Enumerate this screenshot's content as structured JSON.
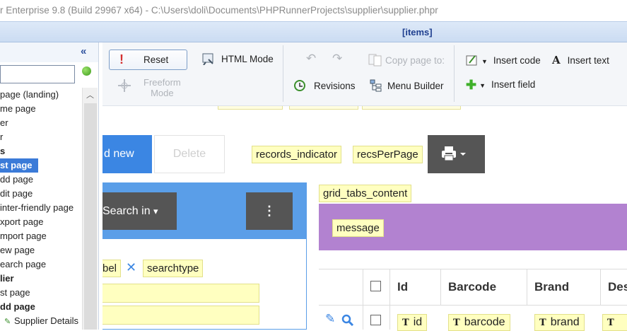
{
  "window": {
    "title": "r Enterprise 9.8 (Build 29967 x64) - C:\\Users\\doli\\Documents\\PHPRunnerProjects\\supplier\\supplier.phpr",
    "doc_title": "[items]"
  },
  "sidebar": {
    "collapse_glyph": "«",
    "search_placeholder": "",
    "items": [
      {
        "label": "page (landing)",
        "style": "normal"
      },
      {
        "label": "me page",
        "style": "normal"
      },
      {
        "label": "er",
        "style": "normal"
      },
      {
        "label": "r",
        "style": "normal"
      },
      {
        "label": "s",
        "style": "bold"
      },
      {
        "label": "st page",
        "style": "selected"
      },
      {
        "label": "dd page",
        "style": "normal"
      },
      {
        "label": "dit page",
        "style": "normal"
      },
      {
        "label": "inter-friendly page",
        "style": "normal"
      },
      {
        "label": "xport page",
        "style": "normal"
      },
      {
        "label": "mport page",
        "style": "normal"
      },
      {
        "label": "ew page",
        "style": "normal"
      },
      {
        "label": "earch page",
        "style": "normal"
      },
      {
        "label": "lier",
        "style": "bold"
      },
      {
        "label": "st page",
        "style": "normal"
      },
      {
        "label": "dd page",
        "style": "bold"
      },
      {
        "label": "Supplier Details",
        "style": "leaf"
      }
    ]
  },
  "toolbar": {
    "reset": "Reset",
    "html_mode": "HTML Mode",
    "freeform_mode_1": "Freeform",
    "freeform_mode_2": "Mode",
    "revisions": "Revisions",
    "copy_page": "Copy page to:",
    "menu_builder": "Menu Builder",
    "insert_code": "Insert code",
    "insert_text": "Insert text",
    "insert_field": "Insert field"
  },
  "page": {
    "add_new": "d new",
    "delete": "Delete",
    "records_indicator": "records_indicator",
    "recs_per_page": "recsPerPage",
    "search_in": "Search in",
    "caret": "▾",
    "kebab": "⋮",
    "grid_tabs_content": "grid_tabs_content",
    "message": "message",
    "label_fragment": "bel",
    "searchtype": "searchtype"
  },
  "grid": {
    "headers": [
      "Id",
      "Barcode",
      "Brand",
      "Des"
    ],
    "fields": [
      "id",
      "barcode",
      "brand",
      ""
    ],
    "field_type_glyph": "T"
  },
  "colors": {
    "accent_blue": "#3b86e3",
    "message_purple": "#b282d0",
    "tag_yellow": "#ffffc0",
    "dark_button": "#555555"
  }
}
